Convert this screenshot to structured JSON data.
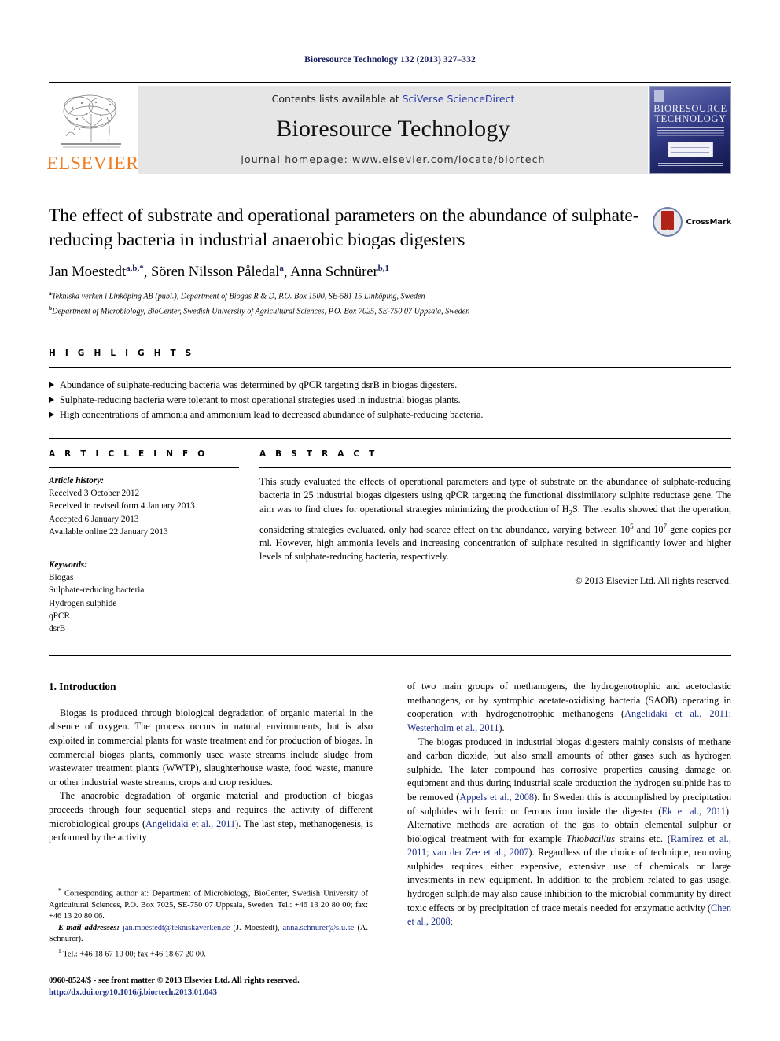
{
  "running_head": "Bioresource Technology 132 (2013) 327–332",
  "banner": {
    "publisher_name": "ELSEVIER",
    "tree_logo": "elsevier-tree-icon",
    "contents_prefix": "Contents lists available at ",
    "contents_link": "SciVerse ScienceDirect",
    "journal_title": "Bioresource Technology",
    "homepage": "journal homepage: www.elsevier.com/locate/biortech",
    "cover": {
      "line1": "BIORESOURCE",
      "line2": "TECHNOLOGY"
    }
  },
  "article": {
    "title": "The effect of substrate and operational parameters on the abundance of sulphate-reducing bacteria in industrial anaerobic biogas digesters",
    "crossmark_label": "CrossMark",
    "authors": [
      {
        "name": "Jan Moestedt",
        "marks": "a,b,*"
      },
      {
        "name": "Sören Nilsson Påledal",
        "marks": "a"
      },
      {
        "name": "Anna Schnürer",
        "marks": "b,1"
      }
    ],
    "authors_line": "Jan Moestedt, Sören Nilsson Påledal, Anna Schnürer",
    "affiliations": [
      {
        "mark": "a",
        "text": "Tekniska verken i Linköping AB (publ.), Department of Biogas R & D, P.O. Box 1500, SE-581 15 Linköping, Sweden"
      },
      {
        "mark": "b",
        "text": "Department of Microbiology, BioCenter, Swedish University of Agricultural Sciences, P.O. Box 7025, SE-750 07 Uppsala, Sweden"
      }
    ]
  },
  "highlights": {
    "heading": "H I G H L I G H T S",
    "items": [
      "Abundance of sulphate-reducing bacteria was determined by qPCR targeting dsrB in biogas digesters.",
      "Sulphate-reducing bacteria were tolerant to most operational strategies used in industrial biogas plants.",
      "High concentrations of ammonia and ammonium lead to decreased abundance of sulphate-reducing bacteria."
    ]
  },
  "article_info": {
    "heading": "A R T I C L E    I N F O",
    "history_label": "Article history:",
    "history": [
      "Received 3 October 2012",
      "Received in revised form 4 January 2013",
      "Accepted 6 January 2013",
      "Available online 22 January 2013"
    ],
    "keywords_label": "Keywords:",
    "keywords": [
      "Biogas",
      "Sulphate-reducing bacteria",
      "Hydrogen sulphide",
      "qPCR",
      "dsrB"
    ]
  },
  "abstract": {
    "heading": "A B S T R A C T",
    "part1": "This study evaluated the effects of operational parameters and type of substrate on the abundance of sulphate-reducing bacteria in 25 industrial biogas digesters using qPCR targeting the functional dissimilatory sulphite reductase gene. The aim was to find clues for operational strategies minimizing the production of H",
    "h2s_sub": "2",
    "part2": "S. The results showed that the operation, considering strategies evaluated, only had scarce effect on the abundance, varying between 10",
    "exp1": "5",
    "part3": " and 10",
    "exp2": "7",
    "part4": " gene copies per ml. However, high ammonia levels and increasing concentration of sulphate resulted in significantly lower and higher levels of sulphate-reducing bacteria, respectively.",
    "copyright": "© 2013 Elsevier Ltd. All rights reserved."
  },
  "body": {
    "section_heading": "1. Introduction",
    "left_p1": "Biogas is produced through biological degradation of organic material in the absence of oxygen. The process occurs in natural environments, but is also exploited in commercial plants for waste treatment and for production of biogas. In commercial biogas plants, commonly used waste streams include sludge from wastewater treatment plants (WWTP), slaughterhouse waste, food waste, manure or other industrial waste streams, crops and crop residues.",
    "left_p2_a": "The anaerobic degradation of organic material and production of biogas proceeds through four sequential steps and requires the activity of different microbiological groups (",
    "left_p2_ref": "Angelidaki et al., 2011",
    "left_p2_b": "). The last step, methanogenesis, is performed by the activity",
    "right_p1_a": "of two main groups of methanogens, the hydrogenotrophic and acetoclastic methanogens, or by syntrophic acetate-oxidising bacteria (SAOB) operating in cooperation with hydrogenotrophic methanogens (",
    "right_p1_ref": "Angelidaki et al., 2011; Westerholm et al., 2011",
    "right_p1_b": ").",
    "right_p2_a": "The biogas produced in industrial biogas digesters mainly consists of methane and carbon dioxide, but also small amounts of other gases such as hydrogen sulphide. The later compound has corrosive properties causing damage on equipment and thus during industrial scale production the hydrogen sulphide has to be removed (",
    "right_p2_ref1": "Appels et al., 2008",
    "right_p2_b": "). In Sweden this is accomplished by precipitation of sulphides with ferric or ferrous iron inside the digester (",
    "right_p2_ref2": "Ek et al., 2011",
    "right_p2_c": "). Alternative methods are aeration of the gas to obtain elemental sulphur or biological treatment with for example ",
    "right_p2_italic": "Thiobacillus",
    "right_p2_d": " strains etc. (",
    "right_p2_ref3": "Ramírez et al., 2011; van der Zee et al., 2007",
    "right_p2_e": "). Regardless of the choice of technique, removing sulphides requires either expensive, extensive use of chemicals or large investments in new equipment. In addition to the problem related to gas usage, hydrogen sulphide may also cause inhibition to the microbial community by direct toxic effects or by precipitation of trace metals needed for enzymatic activity (",
    "right_p2_ref4": "Chen et al., 2008;"
  },
  "footnotes": {
    "corresponding_mark": "*",
    "corresponding": "Corresponding author at: Department of Microbiology, BioCenter, Swedish University of Agricultural Sciences, P.O. Box 7025, SE-750 07 Uppsala, Sweden. Tel.: +46 13 20 80 00; fax: +46 13 20 80 06.",
    "email_label": "E-mail addresses:",
    "email1": "jan.moestedt@tekniskaverken.se",
    "email1_owner": " (J. Moestedt), ",
    "email2": "anna.schnurer@slu.se",
    "email2_owner": " (A. Schnürer).",
    "note1_mark": "1",
    "note1": "Tel.: +46 18 67 10 00; fax +46 18 67 20 00."
  },
  "imprint": {
    "line1": "0960-8524/$ - see front matter © 2013 Elsevier Ltd. All rights reserved.",
    "doi": "http://dx.doi.org/10.1016/j.biortech.2013.01.043"
  },
  "colors": {
    "header_navy": "#1a2160",
    "link_blue": "#2b39a8",
    "ref_blue": "#1d2f8a",
    "elsevier_orange": "#ef7d21",
    "banner_gray": "#e6e6e6"
  }
}
